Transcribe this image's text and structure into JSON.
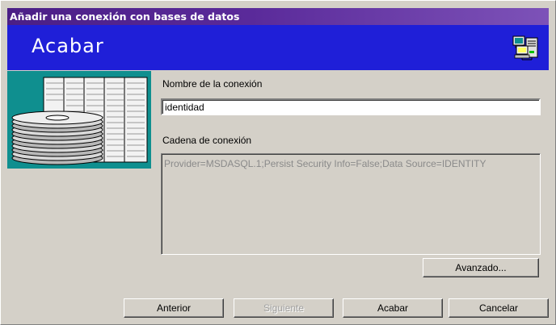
{
  "window": {
    "title": "Añadir una conexión con bases de datos"
  },
  "header": {
    "title": "Acabar",
    "icon": "network-computers-icon"
  },
  "illustration": {
    "icon": "database-stack-icon"
  },
  "connection_name": {
    "label": "Nombre de la conexión",
    "value": "identidad"
  },
  "connection_string": {
    "label": "Cadena de conexión",
    "value": "Provider=MSDASQL.1;Persist Security Info=False;Data Source=IDENTITY"
  },
  "buttons": {
    "advanced": "Avanzado...",
    "back": "Anterior",
    "next": "Siguiente",
    "finish": "Acabar",
    "cancel": "Cancelar"
  },
  "colors": {
    "header_blue": "#1f1fd8",
    "title_bar": "#5a2a9a",
    "art_teal": "#0f8f8f",
    "dialog_gray": "#d4d0c8"
  }
}
